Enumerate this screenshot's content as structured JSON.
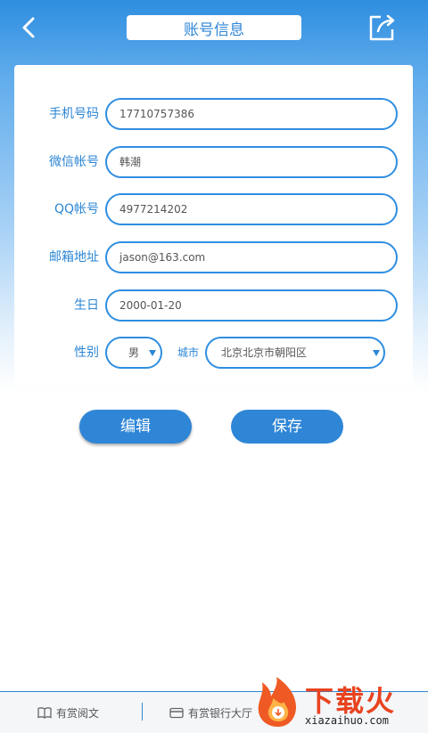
{
  "header": {
    "title": "账号信息",
    "back_icon": "chevron-left-icon",
    "share_icon": "share-edit-icon"
  },
  "form": {
    "phone": {
      "label": "手机号码",
      "value": "17710757386"
    },
    "wechat": {
      "label": "微信帐号",
      "value": "韩潮"
    },
    "qq": {
      "label": "QQ帐号",
      "value": "4977214202"
    },
    "email": {
      "label": "邮箱地址",
      "value": "jason@163.com"
    },
    "birthday": {
      "label": "生日",
      "value": "2000-01-20"
    },
    "gender": {
      "label": "性别",
      "value": "男"
    },
    "city": {
      "label": "城市",
      "value": "北京北京市朝阳区"
    }
  },
  "actions": {
    "edit_label": "编辑",
    "save_label": "保存"
  },
  "bottom_nav": {
    "items": [
      {
        "label": "有赏阅文",
        "icon": "book-icon"
      },
      {
        "label": "有赏银行大厅",
        "icon": "card-icon"
      }
    ]
  },
  "watermark": {
    "text": "下载火",
    "sub": "xiazaihuo.com"
  },
  "colors": {
    "accent": "#2f86d6",
    "header_top": "#2f8ee0",
    "watermark": "#e8431f"
  }
}
